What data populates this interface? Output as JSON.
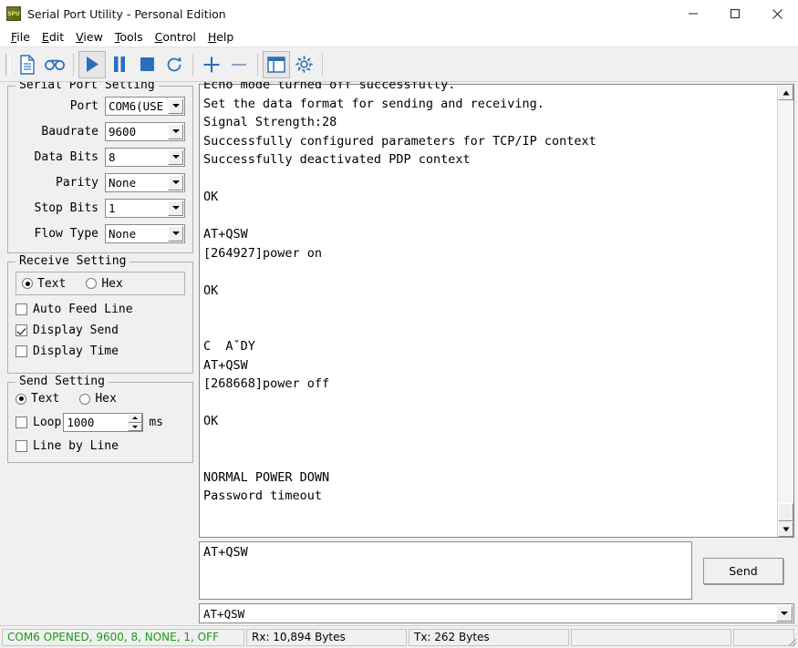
{
  "window": {
    "title": "Serial Port Utility - Personal Edition",
    "app_icon": "spu",
    "minimize_icon": "minimize-icon",
    "maximize_icon": "maximize-icon",
    "close_icon": "close-icon"
  },
  "menubar": {
    "items": [
      {
        "accel": "F",
        "rest": "ile"
      },
      {
        "accel": "E",
        "rest": "dit"
      },
      {
        "accel": "V",
        "rest": "iew"
      },
      {
        "accel": "T",
        "rest": "ools"
      },
      {
        "accel": "C",
        "rest": "ontrol"
      },
      {
        "accel": "H",
        "rest": "elp"
      }
    ]
  },
  "toolbar": {
    "buttons": [
      {
        "name": "new-file-icon",
        "pressed": false
      },
      {
        "name": "record-icon",
        "pressed": false
      },
      {
        "name": "play-icon",
        "pressed": true
      },
      {
        "name": "pause-icon",
        "pressed": false
      },
      {
        "name": "stop-icon",
        "pressed": false
      },
      {
        "name": "refresh-icon",
        "pressed": false
      },
      {
        "name": "plus-icon",
        "pressed": false
      },
      {
        "name": "minus-icon",
        "pressed": false
      },
      {
        "name": "panel-layout-icon",
        "pressed": false
      },
      {
        "name": "gear-icon",
        "pressed": false
      }
    ],
    "accent_color": "#2a6fba"
  },
  "serial_port_setting": {
    "legend": "Serial Port Setting",
    "fields": [
      {
        "label": "Port",
        "value": "COM6(USE"
      },
      {
        "label": "Baudrate",
        "value": "9600"
      },
      {
        "label": "Data Bits",
        "value": "8"
      },
      {
        "label": "Parity",
        "value": "None"
      },
      {
        "label": "Stop Bits",
        "value": "1"
      },
      {
        "label": "Flow Type",
        "value": "None"
      }
    ]
  },
  "receive_setting": {
    "legend": "Receive Setting",
    "format_text_label": "Text",
    "format_hex_label": "Hex",
    "format_selected": "Text",
    "checkboxes": [
      {
        "label": "Auto Feed Line",
        "checked": false
      },
      {
        "label": "Display Send",
        "checked": true
      },
      {
        "label": "Display Time",
        "checked": false
      }
    ]
  },
  "send_setting": {
    "legend": "Send Setting",
    "format_text_label": "Text",
    "format_hex_label": "Hex",
    "format_selected": "Text",
    "loop_label": "Loop",
    "loop_checked": false,
    "loop_value": "1000",
    "loop_unit": "ms",
    "line_by_line_label": "Line by Line",
    "line_by_line_checked": false
  },
  "terminal": {
    "text": "Echo mode turned off successfully.\nSet the data format for sending and receiving.\nSignal Strength:28\nSuccessfully configured parameters for TCP/IP context\nSuccessfully deactivated PDP context\n\nOK\n\nAT+QSW\n[264927]power on\n\nOK\n\n\nC  AˇDY\nAT+QSW\n[268668]power off\n\nOK\n\n\nNORMAL POWER DOWN\nPassword timeout\n",
    "scroll_up_icon": "scroll-up-arrow-icon",
    "scroll_down_icon": "scroll-down-arrow-icon"
  },
  "send_area": {
    "input_value": "AT+QSW",
    "send_button_label": "Send"
  },
  "history": {
    "value": "AT+QSW",
    "dropdown_icon": "chevron-down-icon"
  },
  "statusbar": {
    "connection": "COM6 OPENED, 9600, 8, NONE, 1, OFF",
    "connection_color": "#1a9a1a",
    "rx": "Rx: 10,894 Bytes",
    "tx": "Tx: 262 Bytes",
    "empty1": "",
    "empty2": ""
  }
}
